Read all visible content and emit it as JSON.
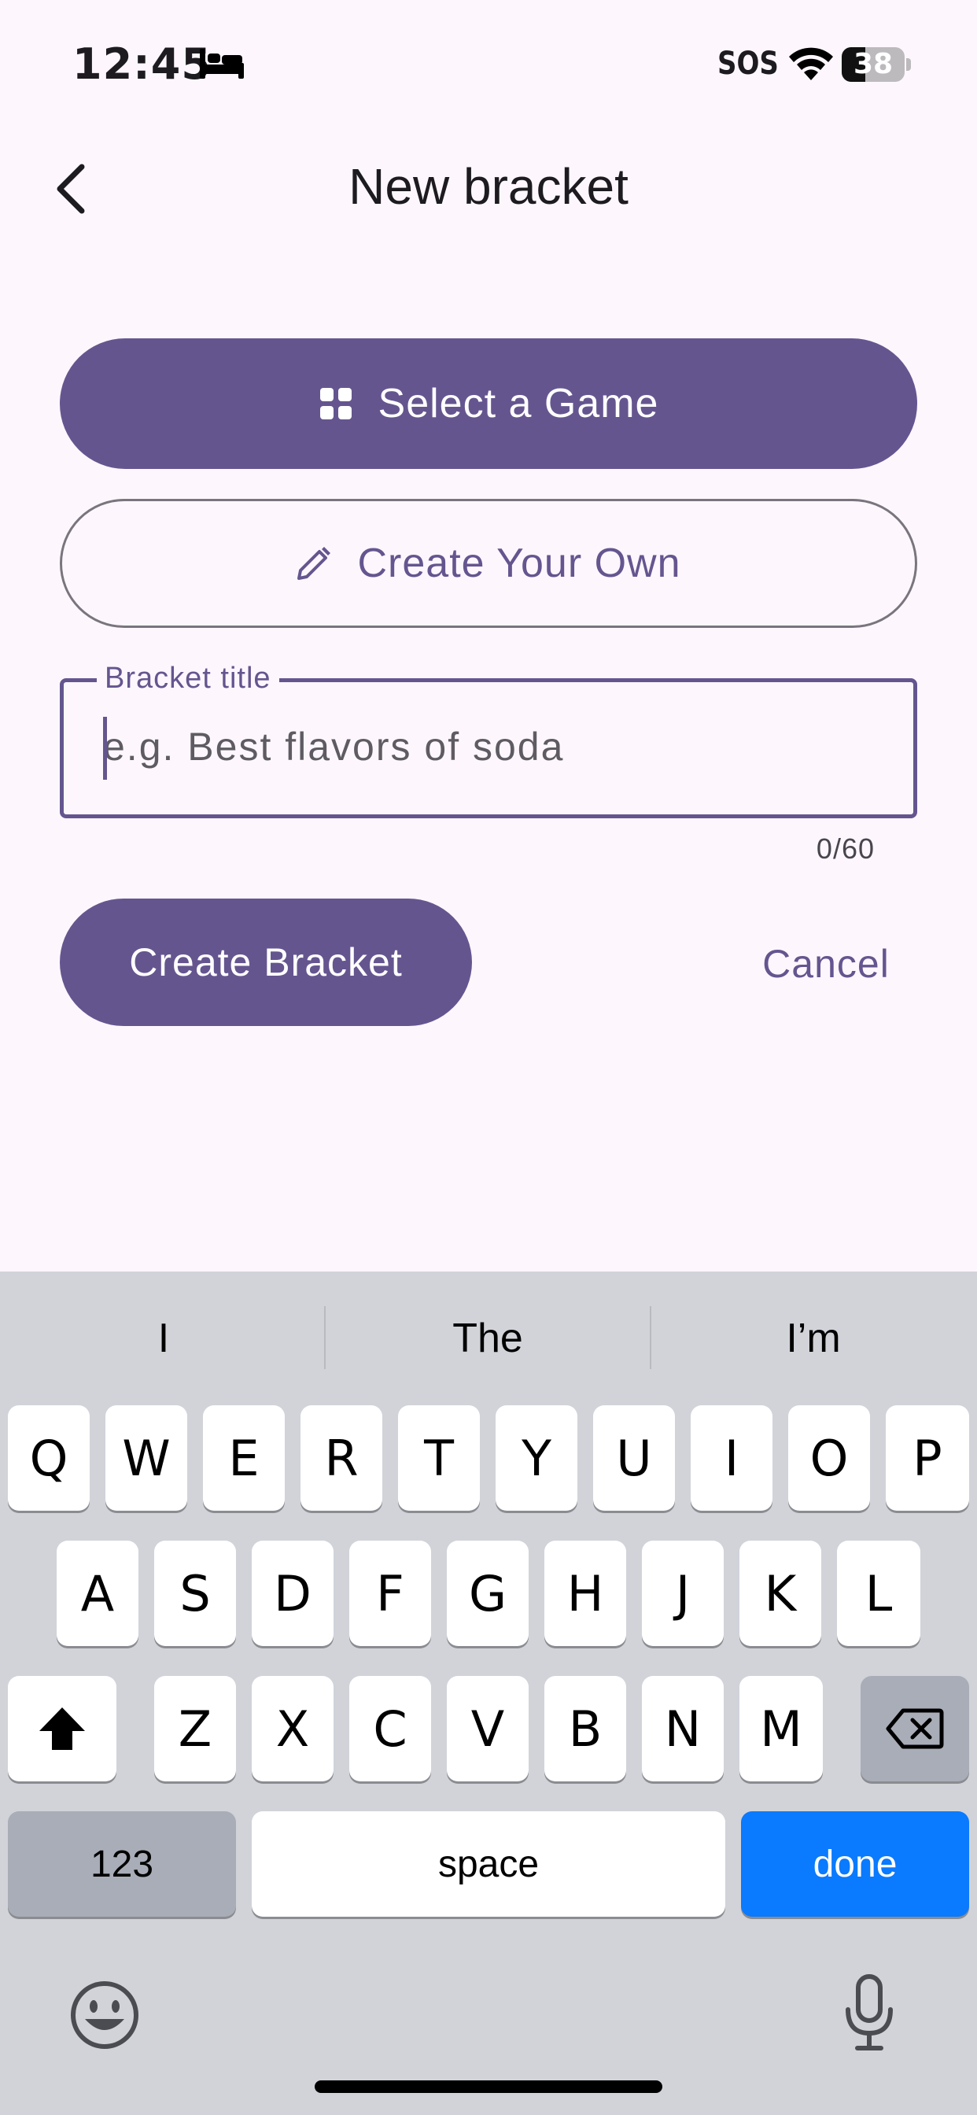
{
  "status_bar": {
    "time": "12:45",
    "carrier": "SOS",
    "battery_level": "38",
    "battery_fraction": 0.38,
    "icons": [
      "bed-icon",
      "wifi-icon",
      "battery-icon"
    ]
  },
  "header": {
    "title": "New bracket",
    "back_icon": "chevron-left-icon"
  },
  "actions": {
    "select_game_label": "Select a Game",
    "select_game_icon": "grid-icon",
    "create_own_label": "Create Your Own",
    "create_own_icon": "pencil-icon"
  },
  "bracket_title_field": {
    "label": "Bracket title",
    "value": "",
    "placeholder": "e.g. Best flavors of soda",
    "counter": "0/60"
  },
  "form_buttons": {
    "create_label": "Create Bracket",
    "cancel_label": "Cancel"
  },
  "colors": {
    "primary": "#65558f",
    "background": "#fdf7fd",
    "outline": "#79747e",
    "keyboard_bg": "#d1d3d9",
    "done_key": "#0a7aff"
  },
  "keyboard": {
    "suggestions": [
      "I",
      "The",
      "I’m"
    ],
    "row1": [
      "Q",
      "W",
      "E",
      "R",
      "T",
      "Y",
      "U",
      "I",
      "O",
      "P"
    ],
    "row2": [
      "A",
      "S",
      "D",
      "F",
      "G",
      "H",
      "J",
      "K",
      "L"
    ],
    "row3": [
      "Z",
      "X",
      "C",
      "V",
      "B",
      "N",
      "M"
    ],
    "numbers_label": "123",
    "space_label": "space",
    "done_label": "done",
    "shift_icon": "shift-icon",
    "backspace_icon": "backspace-icon",
    "emoji_icon": "emoji-icon",
    "mic_icon": "microphone-icon"
  }
}
